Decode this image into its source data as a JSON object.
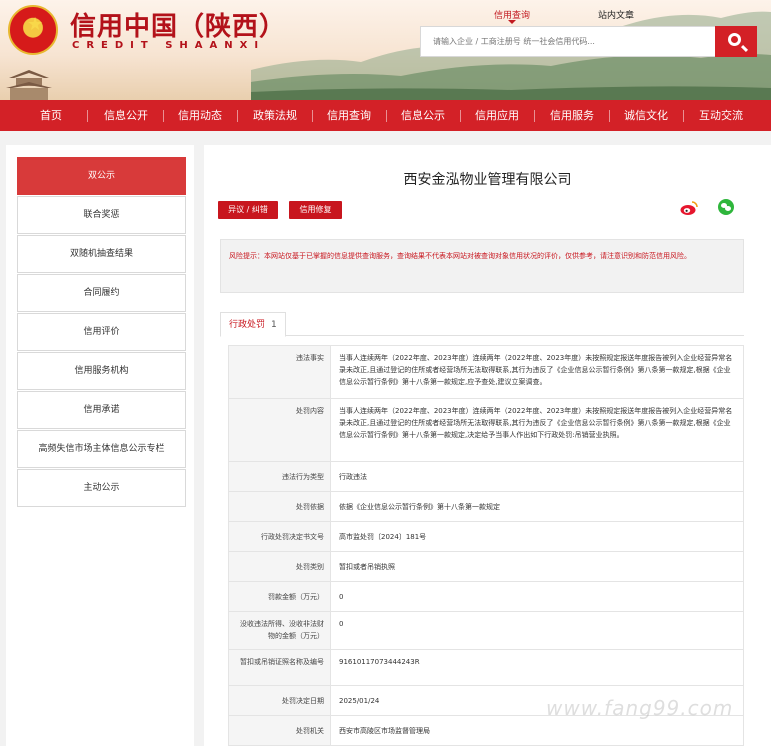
{
  "header": {
    "title": "信用中国（陕西）",
    "subtitle": "CREDIT SHAANXI",
    "search_tabs": [
      "信用查询",
      "站内文章"
    ],
    "search_placeholder": "请输入企业 / 工商注册号 统一社会信用代码..."
  },
  "nav": [
    "首页",
    "信息公开",
    "信用动态",
    "政策法规",
    "信用查询",
    "信息公示",
    "信用应用",
    "信用服务",
    "诚信文化",
    "互动交流"
  ],
  "sidebar": [
    "双公示",
    "联合奖惩",
    "双随机抽查结果",
    "合同履约",
    "信用评价",
    "信用服务机构",
    "信用承诺",
    "高频失信市场主体信息公示专栏",
    "主动公示"
  ],
  "main": {
    "company_name": "西安金泓物业管理有限公司",
    "btn_objection": "异议 / 纠错",
    "btn_repair": "信用修复",
    "notice": "风险提示：本网站仅基于已掌握的信息提供查询服务，查询结果不代表本网站对被查询对象信用状况的评价，仅供参考，请注意识别和防范信用风险。",
    "tab_label": "行政处罚",
    "tab_count": "1"
  },
  "details": [
    {
      "label": "违法事实",
      "value": "当事人连续两年（2022年度、2023年度）连续两年（2022年度、2023年度）未按照规定报送年度报告被列入企业经营异常名录未改正,且通过登记的住所或者经营场所无法取得联系,其行为违反了《企业信息公示暂行条例》第八条第一款规定,根据《企业信息公示暂行条例》第十八条第一款规定,应予查处,建议立案调查。"
    },
    {
      "label": "处罚内容",
      "value": "当事人连续两年（2022年度、2023年度）连续两年（2022年度、2023年度）未按照规定报送年度报告被列入企业经营异常名录未改正,且通过登记的住所或者经营场所无法取得联系,其行为违反了《企业信息公示暂行条例》第八条第一款规定,根据《企业信息公示暂行条例》第十八条第一款规定,决定给予当事人作出如下行政处罚:吊销营业执照。"
    },
    {
      "label": "违法行为类型",
      "value": "行政违法"
    },
    {
      "label": "处罚依据",
      "value": "依据《企业信息公示暂行条例》第十八条第一款规定"
    },
    {
      "label": "行政处罚决定书文号",
      "value": "高市监处罚〔2024〕181号"
    },
    {
      "label": "处罚类别",
      "value": "暂扣或者吊销执照"
    },
    {
      "label": "罚款金额（万元）",
      "value": "0"
    },
    {
      "label": "没收违法所得、没收非法财物的金额（万元）",
      "value": "0"
    },
    {
      "label": "暂扣或吊销证照名称及编号",
      "value": "91610117073444243R"
    },
    {
      "label": "处罚决定日期",
      "value": "2025/01/24"
    },
    {
      "label": "处罚机关",
      "value": "西安市高陵区市场监督管理局"
    }
  ],
  "watermark": "www.fang99.com",
  "colors": {
    "brand_red": "#d32127",
    "accent_red": "#c8161e",
    "wechat_green": "#2fb63c"
  }
}
